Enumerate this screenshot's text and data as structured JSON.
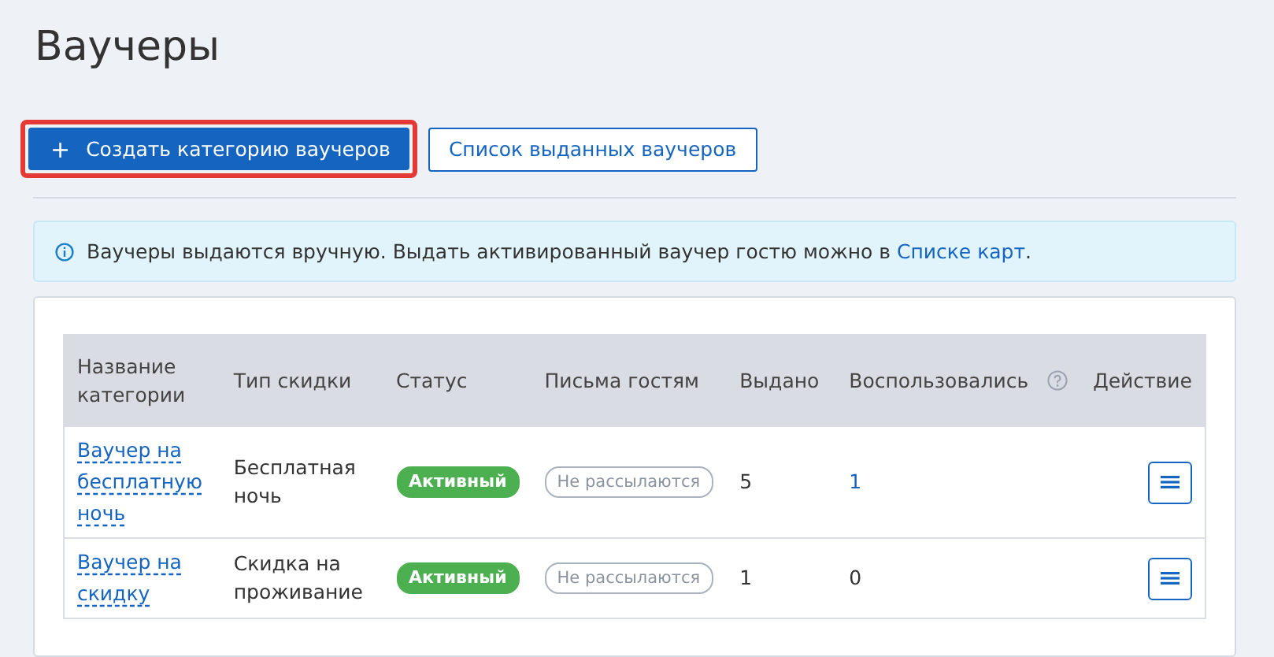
{
  "title": "Ваучеры",
  "create_button": {
    "label": "Создать категорию ваучеров",
    "icon": "+",
    "highlighted": true
  },
  "list_button": {
    "label": "Список выданных ваучеров"
  },
  "info": {
    "text_before": "Ваучеры выдаются вручную. Выдать активированный ваучер гостю можно в ",
    "link": "Списке карт",
    "text_after": "."
  },
  "table": {
    "columns": [
      "Название категории",
      "Тип скидки",
      "Статус",
      "Письма гостям",
      "Выдано",
      "Воспользовались",
      "Действие"
    ],
    "rows": [
      {
        "name": "Ваучер на бесплатную ночь",
        "type": "Бесплатная ночь",
        "status": {
          "label": "Активный",
          "active": true
        },
        "mail": {
          "label": "Не рассылаются",
          "sending": false
        },
        "issued": "5",
        "used": "1",
        "used_link": true
      },
      {
        "name": "Ваучер на скидку",
        "type": "Скидка на проживание",
        "status": {
          "label": "Активный",
          "active": true
        },
        "mail": {
          "label": "Не рассылаются",
          "sending": false
        },
        "issued": "1",
        "used": "0",
        "used_link": false
      }
    ]
  }
}
